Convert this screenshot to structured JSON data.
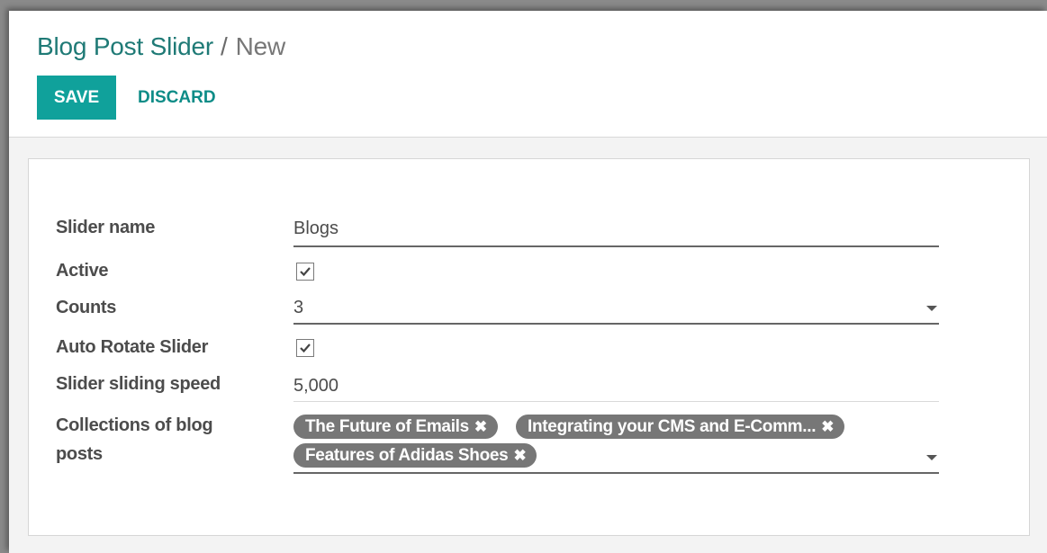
{
  "breadcrumb": {
    "parent": "Blog Post Slider",
    "separator": "/",
    "current": "New"
  },
  "toolbar": {
    "save_label": "SAVE",
    "discard_label": "DISCARD"
  },
  "form": {
    "slider_name": {
      "label": "Slider name",
      "value": "Blogs"
    },
    "active": {
      "label": "Active",
      "checked": true
    },
    "counts": {
      "label": "Counts",
      "value": "3"
    },
    "auto_rotate": {
      "label": "Auto Rotate Slider",
      "checked": true
    },
    "sliding_speed": {
      "label": "Slider sliding speed",
      "value": "5,000"
    },
    "collections": {
      "label_line1": "Collections of blog",
      "label_line2": "posts",
      "tags": [
        "The Future of Emails",
        "Integrating your CMS and E-Comm...",
        "Features of Adidas Shoes"
      ],
      "remove_glyph": "✖"
    }
  },
  "colors": {
    "primary": "#10a19b",
    "breadcrumb_link": "#1f7a76",
    "tag_bg": "#777777"
  }
}
